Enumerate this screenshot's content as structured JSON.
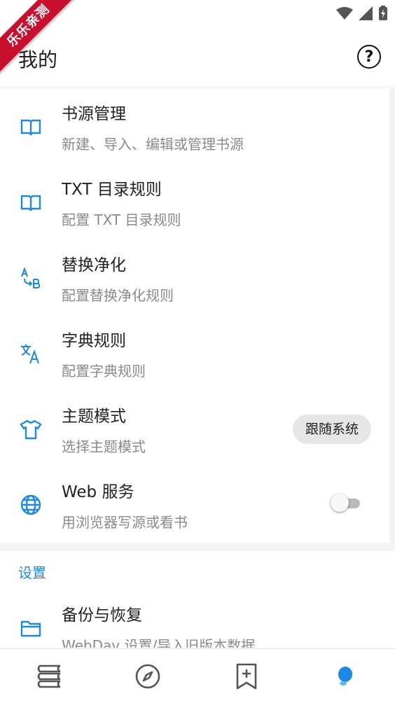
{
  "watermark": {
    "text": "乐乐亲测"
  },
  "status_bar": {
    "icons": [
      "wifi-icon",
      "signal-icon",
      "battery-charging-icon"
    ]
  },
  "app_bar": {
    "title": "我的",
    "help_icon": "help-circle-icon"
  },
  "colors": {
    "accent": "#1e88e5",
    "text_primary": "#212121",
    "text_secondary": "#8a8a8a"
  },
  "items": [
    {
      "icon": "book-open-icon",
      "title": "书源管理",
      "subtitle": "新建、导入、编辑或管理书源"
    },
    {
      "icon": "book-open-icon",
      "title": "TXT 目录规则",
      "subtitle": "配置 TXT 目录规则"
    },
    {
      "icon": "replace-ab-icon",
      "title": "替换净化",
      "subtitle": "配置替换净化规则"
    },
    {
      "icon": "translate-icon",
      "title": "字典规则",
      "subtitle": "配置字典规则"
    },
    {
      "icon": "tshirt-icon",
      "title": "主题模式",
      "subtitle": "选择主题模式",
      "value": "跟随系统"
    },
    {
      "icon": "globe-icon",
      "title": "Web 服务",
      "subtitle": "用浏览器写源或看书",
      "toggle": false
    }
  ],
  "settings": {
    "header": "设置",
    "items": [
      {
        "icon": "folder-icon",
        "title": "备份与恢复",
        "subtitle": "WebDav 设置/导入旧版本数据"
      }
    ]
  },
  "bottom_nav": {
    "items": [
      "bookshelf-icon",
      "explore-compass-icon",
      "bookmark-add-icon",
      "profile-icon"
    ],
    "active": "profile-icon"
  }
}
